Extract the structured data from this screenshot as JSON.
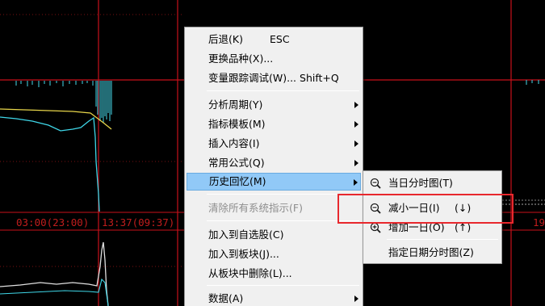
{
  "axis": {
    "time_label_1": "03:00(23:00)",
    "time_label_2": "13:37(09:37)",
    "right_edge_label": "19"
  },
  "main_menu": {
    "back": "后退(K)",
    "back_shortcut": "ESC",
    "change_variety": "更换品种(X)...",
    "var_trace_debug": "变量跟踪调试(W)... Shift+Q",
    "analysis_period": "分析周期(Y)",
    "indicator_template": "指标模板(M)",
    "insert_content": "插入内容(I)",
    "common_formula": "常用公式(Q)",
    "history_review": "历史回忆(M)",
    "clear_system_indicators": "清除所有系统指示(F)",
    "add_to_watchlist": "加入到自选股(C)",
    "add_to_block": "加入到板块(J)...",
    "remove_from_block": "从板块中删除(L)...",
    "data": "数据(A)"
  },
  "sub_menu": {
    "intraday_today": "当日分时图(T)",
    "decrease_day": "减小一日(I)",
    "decrease_hint": "(↓)",
    "increase_day": "增加一日(O)",
    "increase_hint": "(↑)",
    "date_intraday": "指定日期分时图(Z)"
  },
  "colors": {
    "grid_red": "#c8101a",
    "highlight_red": "#e8282d",
    "menu_bg": "#f0f0f0",
    "selected_bg": "#91c9f7"
  }
}
